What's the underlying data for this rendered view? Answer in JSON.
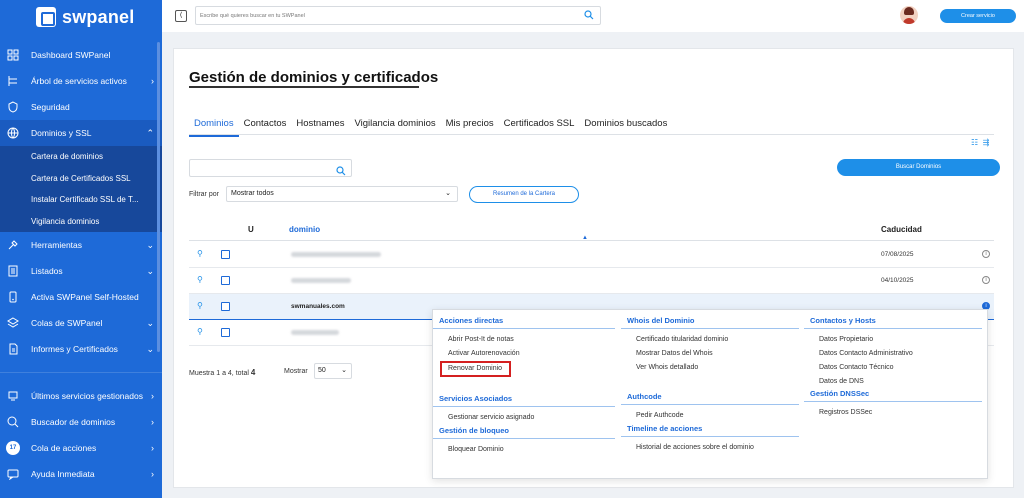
{
  "brand": {
    "name": "swpanel"
  },
  "sidebar": {
    "items": [
      {
        "label": "Dashboard SWPanel",
        "icon": "dashboard-icon",
        "chevron": ""
      },
      {
        "label": "Árbol de servicios activos",
        "icon": "tree-icon",
        "chevron": "›"
      },
      {
        "label": "Seguridad",
        "icon": "shield-icon",
        "chevron": ""
      },
      {
        "label": "Dominios y SSL",
        "icon": "globe-icon",
        "chevron": "⌃"
      }
    ],
    "subitems": [
      "Cartera de dominios",
      "Cartera de Certificados SSL",
      "Instalar Certificado SSL de T...",
      "Vigilancia dominios"
    ],
    "items2": [
      {
        "label": "Herramientas",
        "icon": "tools-icon",
        "chevron": "⌄"
      },
      {
        "label": "Listados",
        "icon": "list-icon",
        "chevron": "⌄"
      },
      {
        "label": "Activa SWPanel Self-Hosted",
        "icon": "server-icon",
        "chevron": ""
      },
      {
        "label": "Colas de SWPanel",
        "icon": "layers-icon",
        "chevron": "⌄"
      },
      {
        "label": "Informes y Certificados",
        "icon": "report-icon",
        "chevron": "⌄"
      }
    ],
    "items3": [
      {
        "label": "Últimos servicios gestionados",
        "icon": "history-icon",
        "chevron": "›"
      },
      {
        "label": "Buscador de dominios",
        "icon": "globe-search-icon",
        "chevron": "›"
      },
      {
        "label": "Cola de acciones",
        "icon": "queue-icon",
        "chevron": "›",
        "badge": "17"
      },
      {
        "label": "Ayuda Inmediata",
        "icon": "help-icon",
        "chevron": "›"
      }
    ]
  },
  "header": {
    "search_placeholder": "Escribe qué quieres buscar en tu SWPanel",
    "create_button": "Crear servicio"
  },
  "main": {
    "title": "Gestión de dominios y certificados",
    "tabs": [
      "Dominios",
      "Contactos",
      "Hostnames",
      "Vigilancia dominios",
      "Mis precios",
      "Certificados SSL",
      "Dominios buscados"
    ],
    "search_button": "Buscar Dominios",
    "filter_label": "Filtrar por",
    "filter_value": "Mostrar todos",
    "summary_button": "Resumen de la Cartera",
    "table": {
      "headers": {
        "u": "U",
        "domain": "dominio",
        "expiry": "Caducidad"
      },
      "rows": [
        {
          "domain": "",
          "expiry": "07/08/2025",
          "blurred": true
        },
        {
          "domain": "",
          "expiry": "04/10/2025",
          "blurred": true
        },
        {
          "domain": "swmanuales.com",
          "expiry": "",
          "blurred": false,
          "highlighted": true
        },
        {
          "domain": "",
          "expiry": "",
          "blurred": true
        }
      ]
    },
    "pagination": {
      "summary_prefix": "Muestra 1 a 4, total",
      "total": "4",
      "show_label": "Mostrar",
      "page_size": "50"
    }
  },
  "actions_menu": {
    "col1": {
      "s1_title": "Acciones directas",
      "s1_items": [
        "Abrir Post-It de notas",
        "Activar Autorenovación",
        "Renovar Dominio"
      ],
      "s2_title": "Servicios Asociados",
      "s2_items": [
        "Gestionar servicio asignado"
      ],
      "s3_title": "Gestión de bloqueo",
      "s3_items": [
        "Bloquear Dominio"
      ]
    },
    "col2": {
      "s1_title": "Whois del Dominio",
      "s1_items": [
        "Certificado titularidad dominio",
        "Mostrar Datos del Whois",
        "Ver Whois detallado"
      ],
      "s2_title": "Authcode",
      "s2_items": [
        "Pedir Authcode"
      ],
      "s3_title": "Timeline de acciones",
      "s3_items": [
        "Historial de acciones sobre el dominio"
      ]
    },
    "col3": {
      "s1_title": "Contactos y Hosts",
      "s1_items": [
        "Datos Propietario",
        "Datos Contacto Administrativo",
        "Datos Contacto Técnico",
        "Datos de DNS"
      ],
      "s2_title": "Gestión DNSSec",
      "s2_items": [
        "Registros DSSec"
      ]
    }
  },
  "colors": {
    "primary": "#1e6ad8",
    "accent": "#1e8fe8",
    "highlight_border": "#d42020"
  }
}
